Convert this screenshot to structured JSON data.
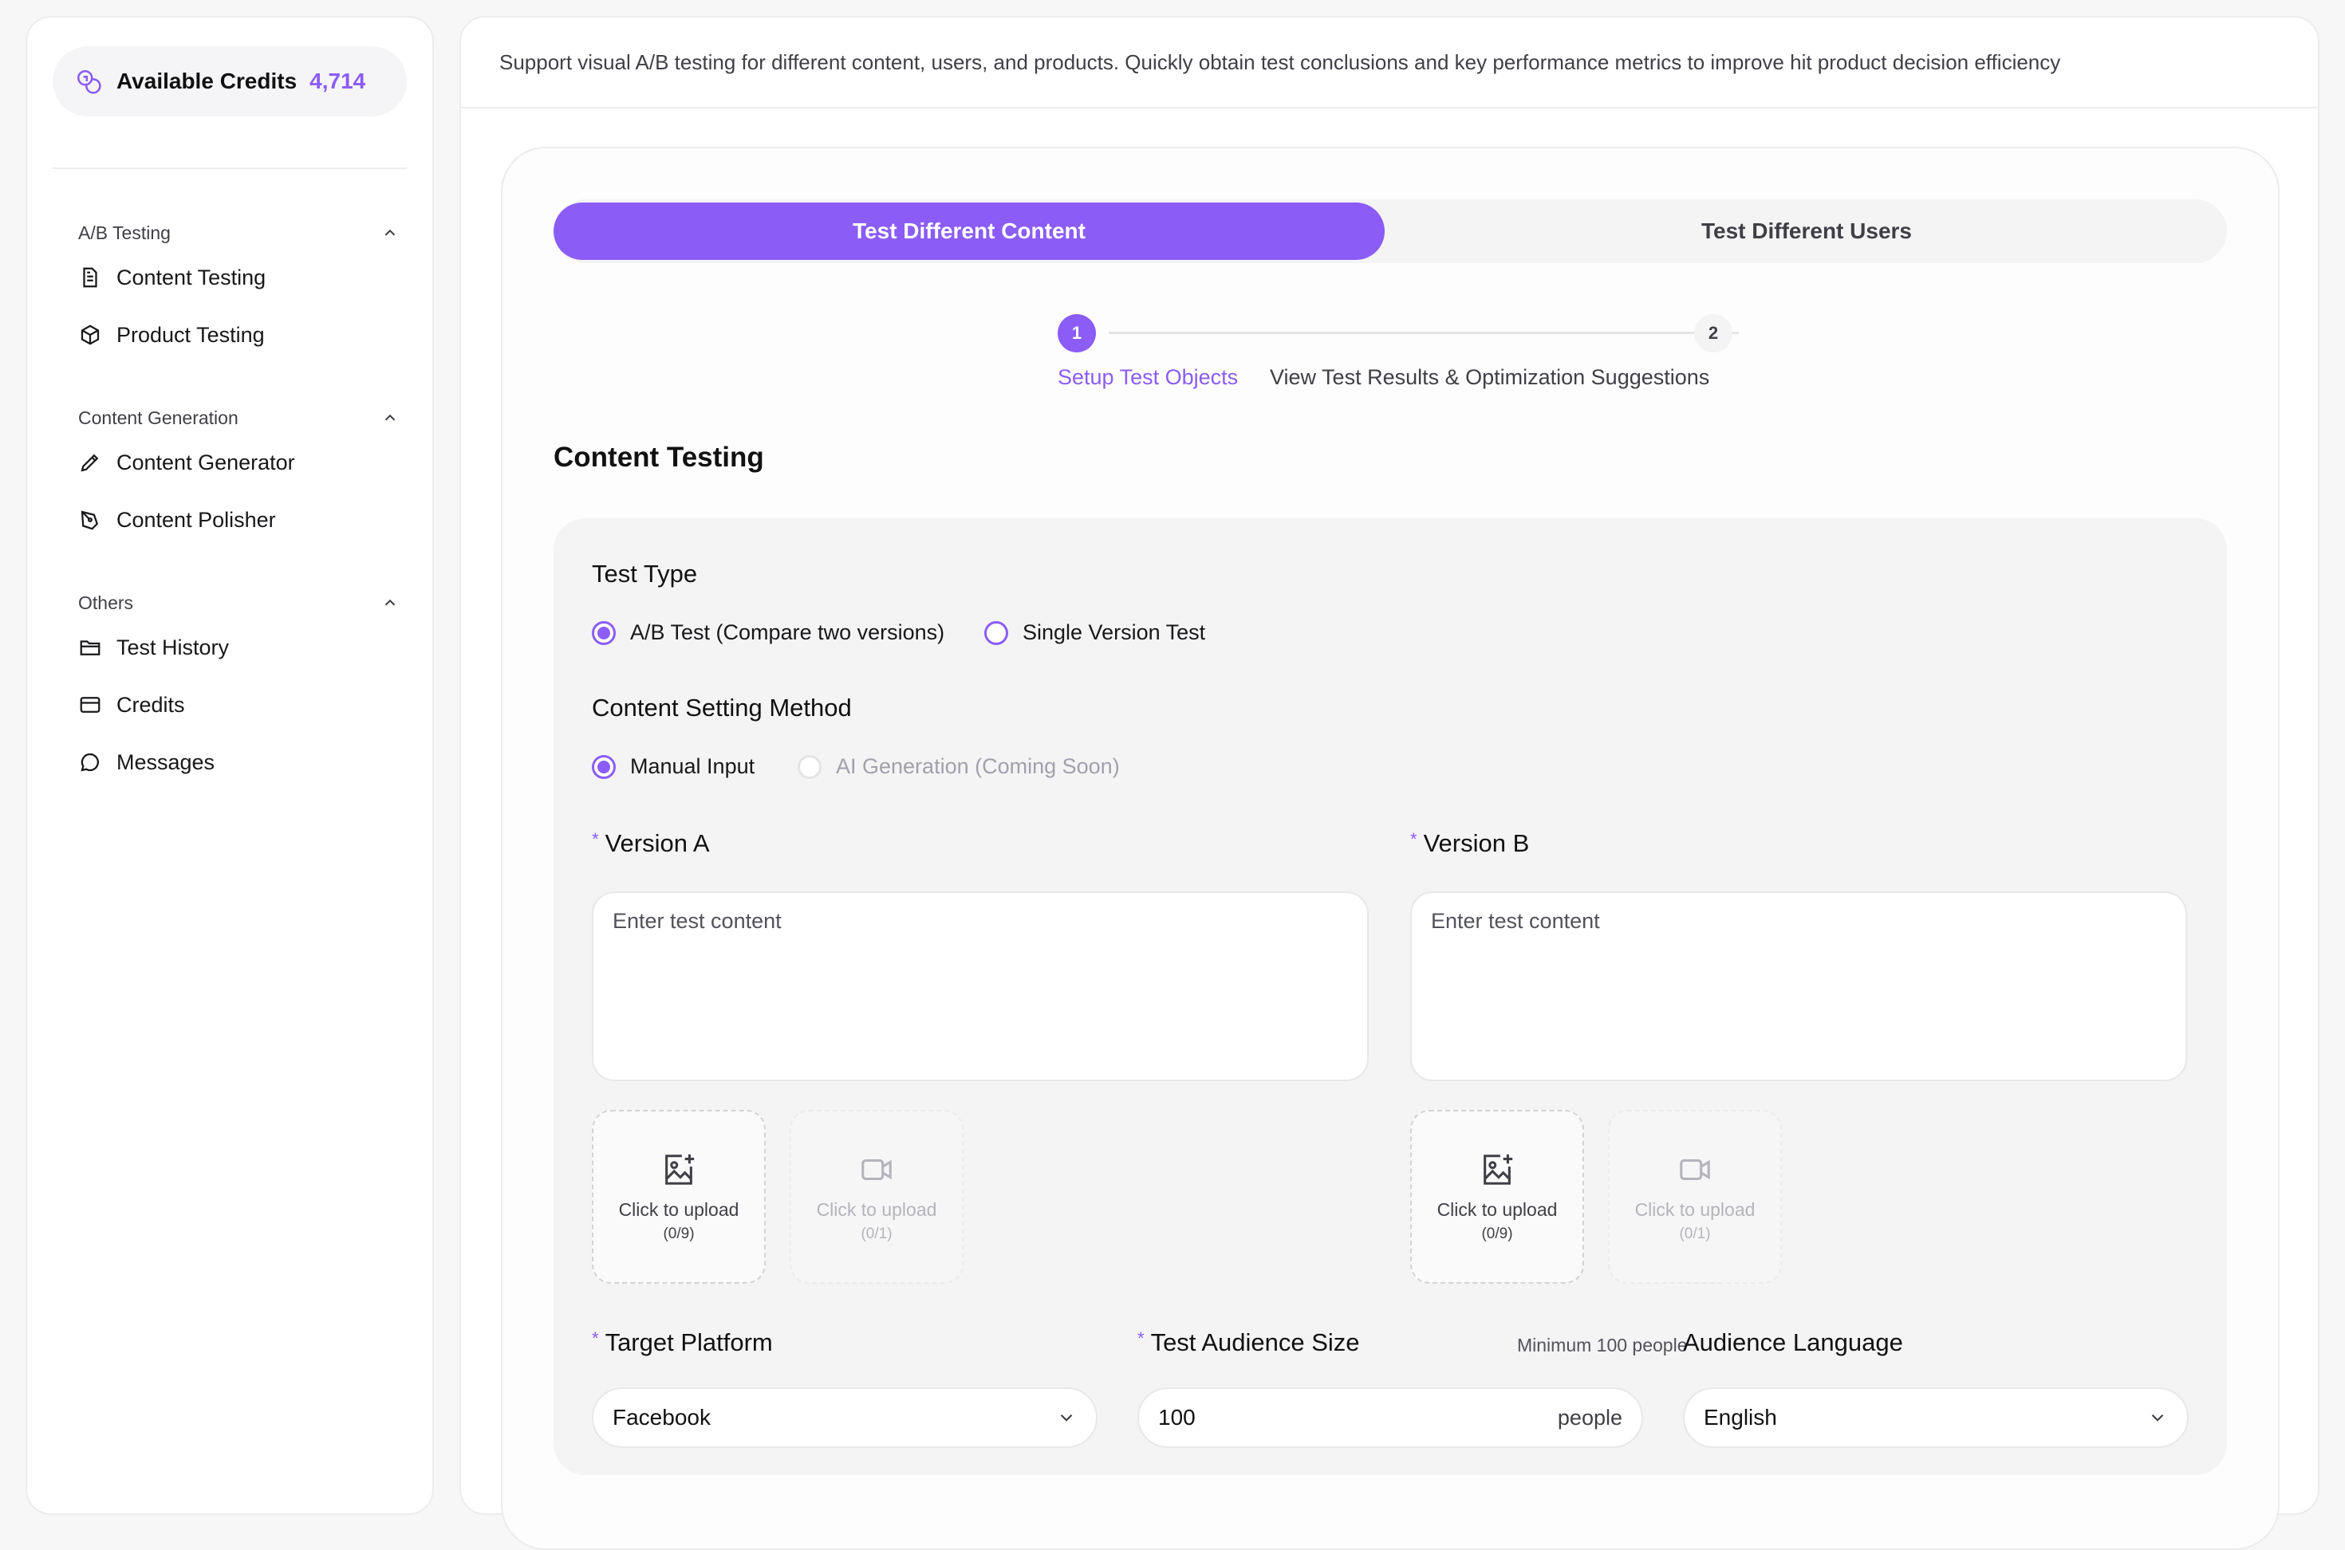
{
  "sidebar": {
    "credits_label": "Available Credits",
    "credits_value": "4,714",
    "groups": [
      {
        "title": "A/B Testing",
        "items": [
          {
            "label": "Content Testing",
            "icon": "document-icon"
          },
          {
            "label": "Product Testing",
            "icon": "cube-icon"
          }
        ]
      },
      {
        "title": "Content Generation",
        "items": [
          {
            "label": "Content Generator",
            "icon": "pencil-icon"
          },
          {
            "label": "Content Polisher",
            "icon": "pen-nib-icon"
          }
        ]
      },
      {
        "title": "Others",
        "items": [
          {
            "label": "Test History",
            "icon": "folder-icon"
          },
          {
            "label": "Credits",
            "icon": "credit-card-icon"
          },
          {
            "label": "Messages",
            "icon": "chat-bubble-icon"
          }
        ]
      }
    ]
  },
  "main": {
    "description": "Support visual A/B testing for different content, users, and products. Quickly obtain test conclusions and key performance metrics to improve hit product decision efficiency",
    "tabs": [
      {
        "label": "Test Different Content",
        "active": true
      },
      {
        "label": "Test Different Users",
        "active": false
      }
    ],
    "steps": [
      {
        "number": "1",
        "label": "Setup Test Objects"
      },
      {
        "number": "2",
        "label": "View Test Results & Optimization Suggestions"
      }
    ],
    "section_title": "Content Testing",
    "form": {
      "test_type_title": "Test Type",
      "test_type_options": [
        {
          "label": "A/B Test (Compare two versions)",
          "selected": true
        },
        {
          "label": "Single Version Test",
          "selected": false
        }
      ],
      "method_title": "Content Setting Method",
      "method_options": [
        {
          "label": "Manual Input",
          "selected": true
        },
        {
          "label": "AI Generation (Coming Soon)",
          "selected": false,
          "disabled": true
        }
      ],
      "required_mark": "*",
      "version_a": {
        "title": "Version A",
        "placeholder": "Enter test content",
        "image_upload": {
          "label": "Click to upload",
          "count": "(0/9)"
        },
        "video_upload": {
          "label": "Click to upload",
          "count": "(0/1)"
        }
      },
      "version_b": {
        "title": "Version B",
        "placeholder": "Enter test content",
        "image_upload": {
          "label": "Click to upload",
          "count": "(0/9)"
        },
        "video_upload": {
          "label": "Click to upload",
          "count": "(0/1)"
        }
      },
      "target_platform": {
        "title": "Target Platform",
        "value": "Facebook"
      },
      "audience_size": {
        "title": "Test Audience Size",
        "hint": "Minimum 100 people",
        "value": "100",
        "unit": "people"
      },
      "audience_language": {
        "title": "Audience Language",
        "value": "English"
      }
    }
  },
  "colors": {
    "accent": "#8b5cf6",
    "panel": "#f4f4f5",
    "border": "#ececef"
  }
}
